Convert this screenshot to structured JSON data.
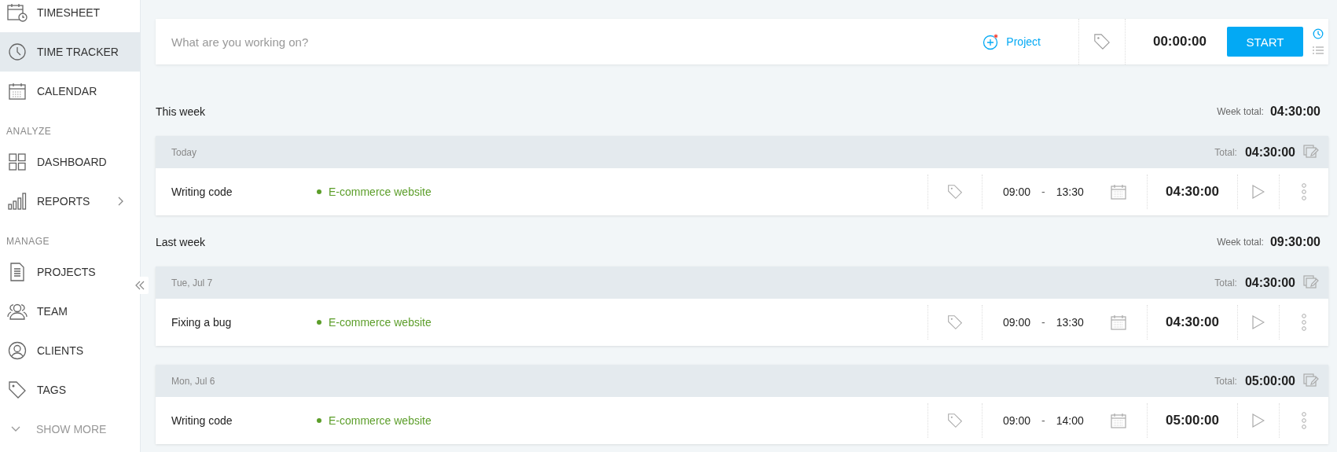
{
  "sidebar": {
    "items": [
      {
        "kind": "item",
        "label": "TIMESHEET",
        "selected": false,
        "expandable": false
      },
      {
        "kind": "item",
        "label": "TIME TRACKER",
        "selected": true,
        "expandable": false
      },
      {
        "kind": "item",
        "label": "CALENDAR",
        "selected": false,
        "expandable": false
      },
      {
        "kind": "section",
        "label": "ANALYZE"
      },
      {
        "kind": "item",
        "label": "DASHBOARD",
        "selected": false,
        "expandable": false
      },
      {
        "kind": "item",
        "label": "REPORTS",
        "selected": false,
        "expandable": true
      },
      {
        "kind": "section",
        "label": "MANAGE"
      },
      {
        "kind": "item",
        "label": "PROJECTS",
        "selected": false,
        "expandable": false
      },
      {
        "kind": "item",
        "label": "TEAM",
        "selected": false,
        "expandable": false
      },
      {
        "kind": "item",
        "label": "CLIENTS",
        "selected": false,
        "expandable": false
      },
      {
        "kind": "item",
        "label": "TAGS",
        "selected": false,
        "expandable": false
      },
      {
        "kind": "more",
        "label": "SHOW MORE"
      }
    ]
  },
  "timer_bar": {
    "placeholder": "What are you working on?",
    "project_label": "Project",
    "timer": "00:00:00",
    "start_button": "START",
    "modes": [
      {
        "selected": true
      },
      {
        "selected": false
      }
    ]
  },
  "weeks": [
    {
      "label": "This week",
      "total_label": "Week total:",
      "total": "04:30:00",
      "days": [
        {
          "label": "Today",
          "total_label": "Total:",
          "total": "04:30:00",
          "entries": [
            {
              "description": "Writing code",
              "project": "E-commerce website",
              "color": "#5c9e2a",
              "start": "09:00",
              "separator": "-",
              "end": "13:30",
              "duration": "04:30:00"
            }
          ]
        }
      ]
    },
    {
      "label": "Last week",
      "total_label": "Week total:",
      "total": "09:30:00",
      "days": [
        {
          "label": "Tue, Jul 7",
          "total_label": "Total:",
          "total": "04:30:00",
          "entries": [
            {
              "description": "Fixing a bug",
              "project": "E-commerce website",
              "color": "#5c9e2a",
              "start": "09:00",
              "separator": "-",
              "end": "13:30",
              "duration": "04:30:00"
            }
          ]
        },
        {
          "label": "Mon, Jul 6",
          "total_label": "Total:",
          "total": "05:00:00",
          "entries": [
            {
              "description": "Writing code",
              "project": "E-commerce website",
              "color": "#5c9e2a",
              "start": "09:00",
              "separator": "-",
              "end": "14:00",
              "duration": "05:00:00"
            }
          ]
        }
      ]
    }
  ]
}
